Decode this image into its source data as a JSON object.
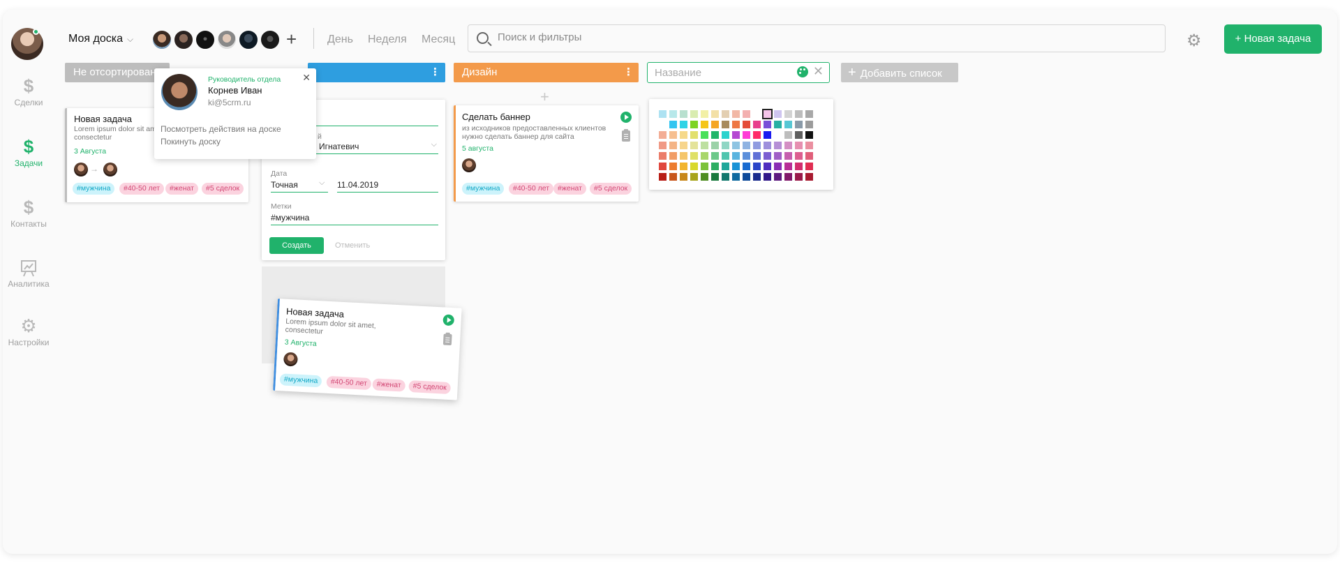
{
  "header": {
    "board_title": "Моя доска",
    "periods": [
      "День",
      "Неделя",
      "Месяц"
    ],
    "search_placeholder": "Поиск и фильтры",
    "new_task_label": "+ Новая задача"
  },
  "sidebar": {
    "items": [
      {
        "label": "Сделки",
        "icon": "dollar-icon"
      },
      {
        "label": "Задачи",
        "icon": "dollar-icon",
        "active": true
      },
      {
        "label": "Контакты",
        "icon": "dollar-icon"
      },
      {
        "label": "Аналитика",
        "icon": "chart-icon"
      },
      {
        "label": "Настройки",
        "icon": "gear-icon"
      }
    ]
  },
  "columns": {
    "col1": {
      "title": "Не отсортирован"
    },
    "col3": {
      "title": "Дизайн"
    },
    "new_list_placeholder": "Название",
    "add_list_label": "Добавить список"
  },
  "popup": {
    "role": "Руководитель отдела",
    "name": "Корнев Иван",
    "email": "ki@5crm.ru",
    "view_actions": "Посмотреть действия на доске",
    "leave_board": "Покинуть доску"
  },
  "card1": {
    "title": "Новая задача",
    "desc1": "Lorem ipsum dolor sit am",
    "desc2": "consectetur",
    "date": "3 Августа",
    "tags": [
      "#мужчина",
      "#40-50 лет",
      "#женат",
      "#5 сделок"
    ]
  },
  "form": {
    "label_person": "й",
    "person_value": "Игнатевич",
    "label_date": "Дата",
    "date_type": "Точная",
    "date_value": "11.04.2019",
    "label_tags": "Метки",
    "tags_value": "#мужчина",
    "create_label": "Создать",
    "cancel_label": "Отменить"
  },
  "card_design": {
    "title": "Сделать баннер",
    "desc1": "из исходников предоставленных клиентов",
    "desc2": "нужно сделать баннер для сайта",
    "date": "5 августа",
    "tags": [
      "#мужчина",
      "#40-50 лет",
      "#женат",
      "#5 сделок"
    ]
  },
  "card_drag": {
    "title": "Новая задача",
    "desc1": "Lorem ipsum dolor sit amet,",
    "desc2": "consectetur",
    "date": "3 Августа",
    "tags": [
      "#мужчина",
      "#40-50 лет",
      "#женат",
      "#5 сделок"
    ]
  },
  "colors": {
    "accent": "#20b26b",
    "col1_header": "#bdbdbd",
    "col2_header": "#2e9ee0",
    "col3_header": "#f39a4a",
    "drag_border": "#3f8ee0",
    "palette": [
      [
        "#aee2f2",
        "#b7e8ea",
        "#b8e0cf",
        "#d9ecb0",
        "#f2f0a6",
        "#f3e0a6",
        "#e3cfb2",
        "#f2b8a6",
        "#f3b0b0",
        "#ffffff",
        "#f5c5ea",
        "#cfc5f0",
        "#d3d3d3",
        "#bdbdbd",
        "#a8a8a8"
      ],
      [
        "#ffffff",
        "#33c5f0",
        "#2fd3e6",
        "#7ed321",
        "#f5c518",
        "#f5a623",
        "#a88b5c",
        "#ee7744",
        "#e44d3a",
        "#e83e8c",
        "#7a4fd8",
        "#27b0a3",
        "#57c7d4",
        "#8a9aa8",
        "#9b9b9b"
      ],
      [
        "#f3ae96",
        "#f6bf90",
        "#f6d98a",
        "#e2e06c",
        "#48e05a",
        "#21b66a",
        "#2bd3cd",
        "#b548d2",
        "#ff3cd6",
        "#ff2a6a",
        "#1a1af0",
        "#ffffff",
        "#bdbdbd",
        "#5f5f5f",
        "#111111"
      ],
      [
        "#f09a86",
        "#f4b486",
        "#f7d58c",
        "#e4e39a",
        "#bde0a0",
        "#9bd2a8",
        "#8fd6c4",
        "#8ec4e2",
        "#8fb3e2",
        "#8f9be0",
        "#9d8fdc",
        "#b58fd6",
        "#d48fc4",
        "#e68fb0",
        "#ea8fa0"
      ],
      [
        "#eb7d6a",
        "#f19d66",
        "#f5c66a",
        "#dfe066",
        "#a8d66a",
        "#6cc98a",
        "#4fc5ae",
        "#5ab4df",
        "#5c8fdb",
        "#5f70d6",
        "#7b5fd2",
        "#a05fc6",
        "#c65fae",
        "#dc5f90",
        "#e05f7a"
      ],
      [
        "#e0483e",
        "#ec7c2e",
        "#f2b52e",
        "#d8d82c",
        "#7cc23a",
        "#2eae62",
        "#1ea79a",
        "#1a93d6",
        "#1a6bd0",
        "#2a45c8",
        "#4f2ec0",
        "#8a2eb4",
        "#b82e96",
        "#d22e6e",
        "#e02e52"
      ],
      [
        "#b81e16",
        "#c8561a",
        "#c8881a",
        "#a8a41a",
        "#4f8e22",
        "#1a7a3e",
        "#12786e",
        "#106aa0",
        "#0e4a9a",
        "#1a2c8e",
        "#32198a",
        "#5e1a80",
        "#82196a",
        "#9a1a4a",
        "#a81a30"
      ]
    ]
  }
}
